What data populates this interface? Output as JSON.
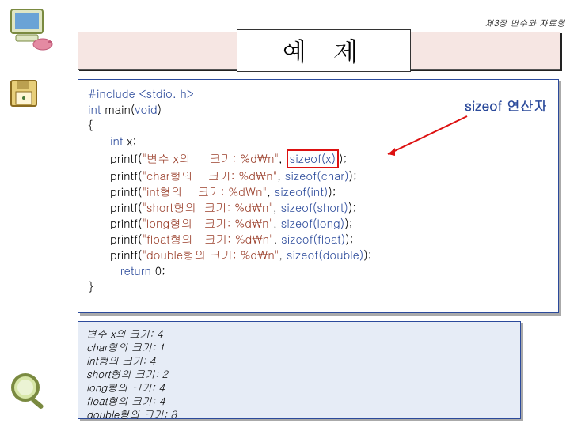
{
  "header": {
    "chapter": "제3장 변수와 자료형"
  },
  "title": "예 제",
  "annotation": {
    "label": "sizeof 연산자"
  },
  "code": {
    "l1": "#include <stdio. h>",
    "l2a": "int",
    "l2b": " main(",
    "l2c": "void",
    "l2d": ")",
    "l3": "{",
    "l4a": "int",
    "l4b": " x;",
    "l5a": "printf(",
    "l5b": "\"변수 x의     크기: %d\\n\"",
    "l5c": ", ",
    "l5box": "sizeof(x)",
    "l5d": ");",
    "l6a": "printf(",
    "l6b": "\"char형의    크기: %d\\n\"",
    "l6c": ", ",
    "l6d": "sizeof(char)",
    "l6e": ");",
    "l7a": "printf(",
    "l7b": "\"int형의    크기: %d\\n\"",
    "l7c": ", ",
    "l7d": "sizeof(int)",
    "l7e": ");",
    "l8a": "printf(",
    "l8b": "\"short형의  크기: %d\\n\"",
    "l8c": ", ",
    "l8d": "sizeof(short)",
    "l8e": ");",
    "l9a": "printf(",
    "l9b": "\"long형의   크기: %d\\n\"",
    "l9c": ", ",
    "l9d": "sizeof(long)",
    "l9e": ");",
    "l10a": "printf(",
    "l10b": "\"float형의   크기: %d\\n\"",
    "l10c": ", ",
    "l10d": "sizeof(float)",
    "l10e": ");",
    "l11a": "printf(",
    "l11b": "\"double형의 크기: %d\\n\"",
    "l11c": ", ",
    "l11d": "sizeof(double)",
    "l11e": ");",
    "l12a": " return",
    "l12b": " 0;",
    "l13": "}"
  },
  "output": {
    "o1": "변수 x의 크기: 4",
    "o2": "char형의 크기: 1",
    "o3": "int형의 크기: 4",
    "o4": "short형의 크기: 2",
    "o5": "long형의 크기: 4",
    "o6": "float형의 크기: 4",
    "o7": "double형의 크기: 8"
  },
  "icons": {
    "monitor": "monitor-icon",
    "floppy": "floppy-icon",
    "magnifier": "magnifier-icon"
  }
}
